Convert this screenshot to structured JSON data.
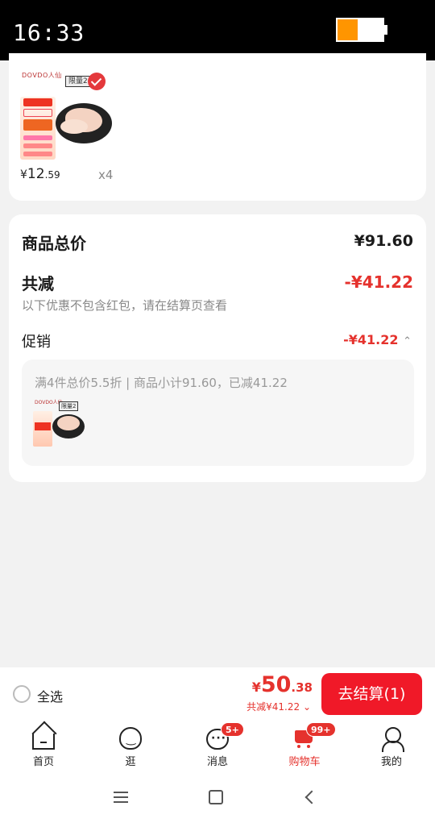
{
  "status_bar": {
    "time": "16:33",
    "battery_level": 0.45,
    "battery_color": "#ff9500"
  },
  "cart_item": {
    "brand": "DOVDO人仙",
    "limit_tag": "限量2",
    "price_yen": "¥",
    "price_int": "12",
    "price_cents": ".59",
    "quantity": "x4"
  },
  "summary": {
    "total_label": "商品总价",
    "total_value": "¥91.60",
    "discount_label": "共减",
    "discount_value": "-¥41.22",
    "discount_note": "以下优惠不包含红包，请在结算页查看",
    "promo_label": "促销",
    "promo_value": "-¥41.22",
    "promo_caret": "⌃",
    "promo_desc": "满4件总价5.5折 | 商品小计91.60，已减41.22",
    "mini_tag": "限量2",
    "mini_brand": "DOVDO人仙"
  },
  "checkout": {
    "select_all": "全选",
    "pay_yen": "¥",
    "pay_int": "50",
    "pay_dec": ".38",
    "pay_discount": "共减¥41.22 ⌄",
    "button": "去结算(1)"
  },
  "tabs": [
    {
      "label": "首页",
      "icon": "home-icon"
    },
    {
      "label": "逛",
      "icon": "browse-icon"
    },
    {
      "label": "消息",
      "icon": "message-icon",
      "badge": "5+"
    },
    {
      "label": "购物车",
      "icon": "cart-icon",
      "badge": "99+",
      "active": true
    },
    {
      "label": "我的",
      "icon": "profile-icon"
    }
  ],
  "colors": {
    "accent": "#e5322d",
    "checkout_button": "#f01928",
    "background": "#f2f2f2"
  }
}
